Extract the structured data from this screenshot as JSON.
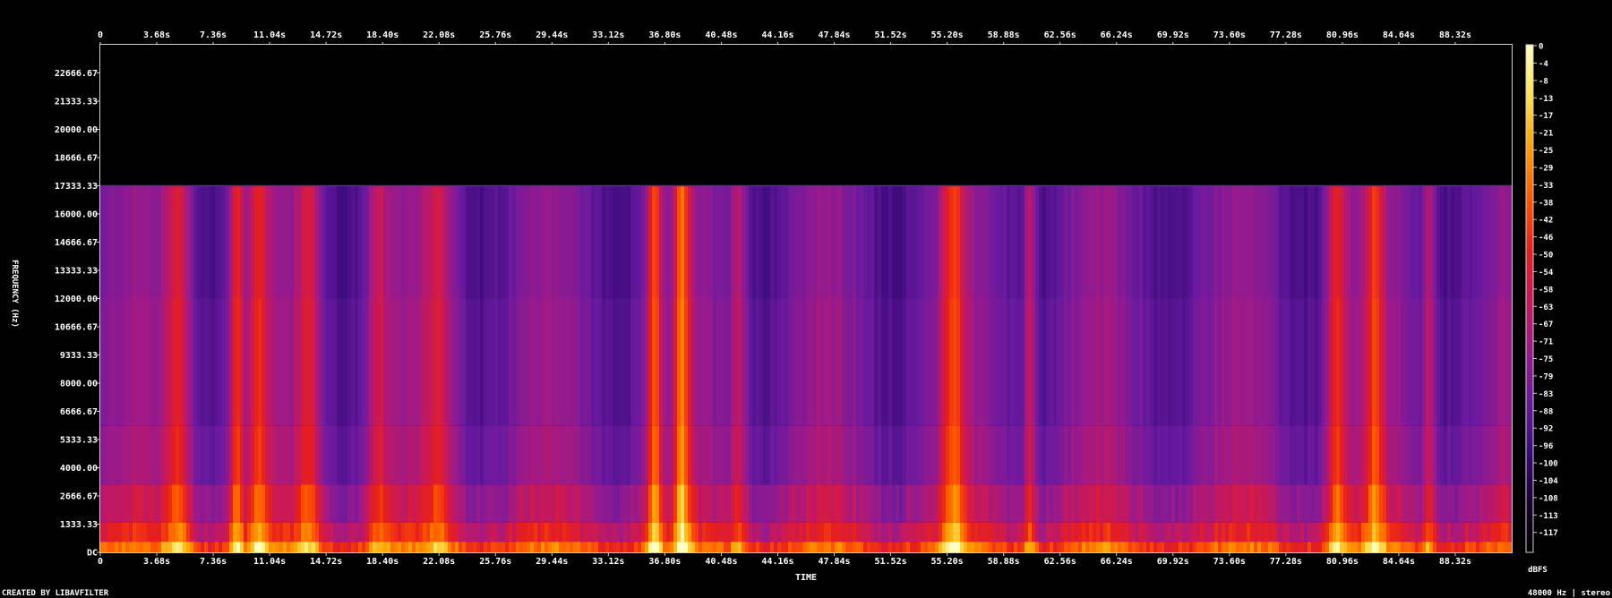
{
  "footer": {
    "credit": "CREATED BY LIBAVFILTER",
    "sample_info": "48000 Hz | stereo"
  },
  "chart_data": {
    "type": "heatmap",
    "title": "",
    "xlabel": "TIME",
    "ylabel": "FREQUENCY (Hz)",
    "colorbar_label": "dBFS",
    "x_ticks": [
      "0",
      "3.68s",
      "7.36s",
      "11.04s",
      "14.72s",
      "18.40s",
      "22.08s",
      "25.76s",
      "29.44s",
      "33.12s",
      "36.80s",
      "40.48s",
      "44.16s",
      "47.84s",
      "51.52s",
      "55.20s",
      "58.88s",
      "62.56s",
      "66.24s",
      "69.92s",
      "73.60s",
      "77.28s",
      "80.96s",
      "84.64s",
      "88.32s"
    ],
    "x_tick_step_s": 3.68,
    "x_range_s": [
      0,
      92.0
    ],
    "y_ticks": [
      "DC",
      "1333.33",
      "2666.67",
      "4000.00",
      "5333.33",
      "6666.67",
      "8000.00",
      "9333.33",
      "10666.67",
      "12000.00",
      "13333.33",
      "14666.67",
      "16000.00",
      "17333.33",
      "18666.67",
      "20000.00",
      "21333.33",
      "22666.67"
    ],
    "y_range_hz": [
      0,
      24000
    ],
    "lowpass_cutoff_hz": 17333.33,
    "colorbar_ticks": [
      "0",
      "-4",
      "-8",
      "-13",
      "-17",
      "-21",
      "-25",
      "-29",
      "-33",
      "-38",
      "-42",
      "-46",
      "-50",
      "-54",
      "-58",
      "-63",
      "-67",
      "-71",
      "-75",
      "-79",
      "-83",
      "-88",
      "-92",
      "-96",
      "-100",
      "-104",
      "-108",
      "-113",
      "-117"
    ],
    "colorbar_range_db": [
      -120,
      0
    ],
    "colormap": [
      "#000000",
      "#1a0033",
      "#3a0a7a",
      "#6a1aa0",
      "#9a1a8a",
      "#c8185a",
      "#e8201a",
      "#ff5a00",
      "#ffa000",
      "#ffe050",
      "#ffffc0"
    ],
    "loud_regions_s": [
      {
        "t": 5.0,
        "w": 0.9,
        "level": 0.75
      },
      {
        "t": 8.8,
        "w": 0.5,
        "level": 0.85
      },
      {
        "t": 10.2,
        "w": 0.6,
        "level": 0.7
      },
      {
        "t": 13.5,
        "w": 0.8,
        "level": 0.65
      },
      {
        "t": 18.0,
        "w": 0.6,
        "level": 0.55
      },
      {
        "t": 22.0,
        "w": 1.0,
        "level": 0.55
      },
      {
        "t": 36.0,
        "w": 0.5,
        "level": 0.95
      },
      {
        "t": 37.8,
        "w": 0.5,
        "level": 0.95
      },
      {
        "t": 41.5,
        "w": 0.6,
        "level": 0.6
      },
      {
        "t": 55.5,
        "w": 0.7,
        "level": 0.8
      },
      {
        "t": 60.5,
        "w": 0.4,
        "level": 0.7
      },
      {
        "t": 80.5,
        "w": 0.7,
        "level": 0.8
      },
      {
        "t": 83.0,
        "w": 0.6,
        "level": 0.7
      },
      {
        "t": 86.5,
        "w": 0.4,
        "level": 0.6
      }
    ]
  }
}
